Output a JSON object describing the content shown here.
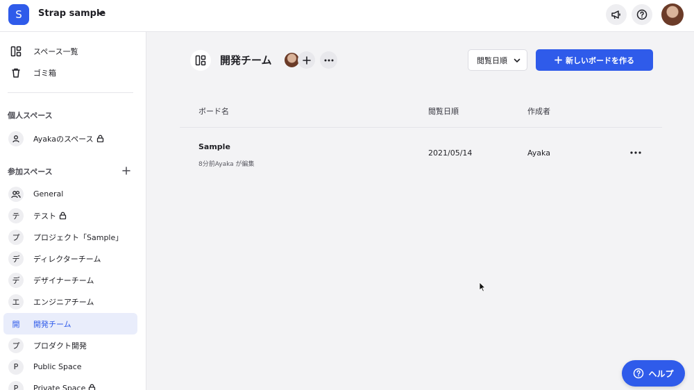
{
  "workspace": {
    "badge": "S",
    "name": "Strap sample"
  },
  "sidebar": {
    "top_items": [
      {
        "label": "スペース一覧",
        "icon": "board-icon"
      },
      {
        "label": "ゴミ箱",
        "icon": "trash-icon"
      }
    ],
    "personal_heading": "個人スペース",
    "personal_item": {
      "label": "Ayakaのスペース",
      "icon": "person-icon",
      "locked": true
    },
    "joined_heading": "参加スペース",
    "spaces": [
      {
        "initial": "",
        "label": "General",
        "icon": "people-icon"
      },
      {
        "initial": "テ",
        "label": "テスト",
        "locked": true
      },
      {
        "initial": "プ",
        "label": "プロジェクト「Sample」"
      },
      {
        "initial": "デ",
        "label": "ディレクターチーム"
      },
      {
        "initial": "デ",
        "label": "デザイナーチーム"
      },
      {
        "initial": "エ",
        "label": "エンジニアチーム"
      },
      {
        "initial": "開",
        "label": "開発チーム",
        "active": true
      },
      {
        "initial": "プ",
        "label": "プロダクト開発"
      },
      {
        "initial": "P",
        "label": "Public Space"
      },
      {
        "initial": "P",
        "label": "Private Space",
        "locked": true
      }
    ]
  },
  "header": {
    "title": "開発チーム",
    "sort_label": "閲覧日順",
    "new_board_label": "新しいボードを作る"
  },
  "table": {
    "columns": {
      "name": "ボード名",
      "viewed": "閲覧日順",
      "creator": "作成者"
    },
    "rows": [
      {
        "title": "Sample",
        "subtitle": "8分前Ayaka が編集",
        "date": "2021/05/14",
        "author": "Ayaka"
      }
    ]
  },
  "help": {
    "label": "ヘルプ"
  },
  "colors": {
    "accent": "#2f5bea",
    "active_bg": "#e9edfb",
    "canvas": "#f3f3f5"
  }
}
